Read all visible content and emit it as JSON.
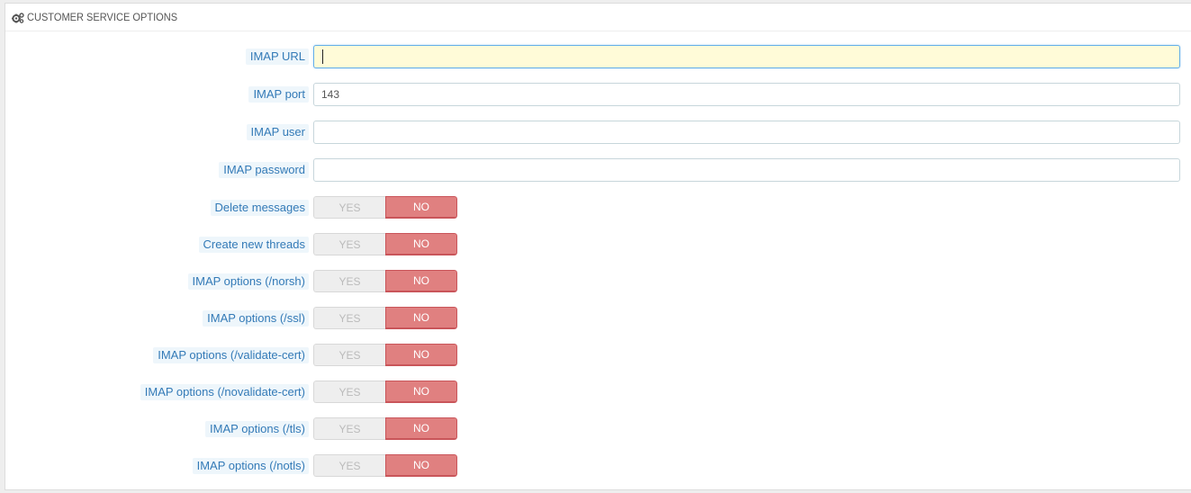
{
  "section": {
    "title": "CUSTOMER SERVICE OPTIONS",
    "icon": "cogs-icon"
  },
  "fields": [
    {
      "label": "IMAP URL",
      "value": "",
      "placeholder": ""
    },
    {
      "label": "IMAP port",
      "value": "143",
      "placeholder": ""
    },
    {
      "label": "IMAP user",
      "value": "",
      "placeholder": ""
    },
    {
      "label": "IMAP password",
      "value": "",
      "placeholder": ""
    }
  ],
  "toggles": [
    {
      "label": "Delete messages",
      "yes": "YES",
      "no": "NO",
      "selected": "NO"
    },
    {
      "label": "Create new threads",
      "yes": "YES",
      "no": "NO",
      "selected": "NO"
    },
    {
      "label": "IMAP options (/norsh)",
      "yes": "YES",
      "no": "NO",
      "selected": "NO"
    },
    {
      "label": "IMAP options (/ssl)",
      "yes": "YES",
      "no": "NO",
      "selected": "NO"
    },
    {
      "label": "IMAP options (/validate-cert)",
      "yes": "YES",
      "no": "NO",
      "selected": "NO"
    },
    {
      "label": "IMAP options (/novalidate-cert)",
      "yes": "YES",
      "no": "NO",
      "selected": "NO"
    },
    {
      "label": "IMAP options (/tls)",
      "yes": "YES",
      "no": "NO",
      "selected": "NO"
    },
    {
      "label": "IMAP options (/notls)",
      "yes": "YES",
      "no": "NO",
      "selected": "NO"
    }
  ],
  "colors": {
    "label_text": "#337ab7",
    "no_active": "#e08080",
    "focused_input_bg": "#fffbd8"
  }
}
